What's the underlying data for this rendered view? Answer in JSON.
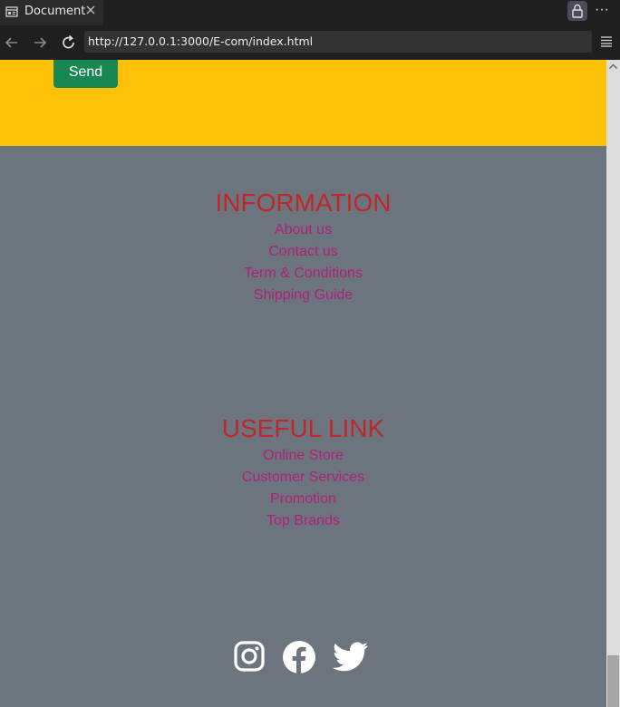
{
  "browser": {
    "tab_title": "Document",
    "url": "http://127.0.0.1:3000/E-com/index.html",
    "more_label": "···"
  },
  "page": {
    "send_label": "Send",
    "information": {
      "heading": "INFORMATION",
      "links": [
        "About us",
        "Contact us",
        "Term & Conditions",
        "Shipping Guide"
      ]
    },
    "useful": {
      "heading": "USEFUL LINK",
      "links": [
        "Online Store",
        "Customer Services",
        "Promotion",
        "Top Brands"
      ]
    },
    "social": [
      "instagram-icon",
      "facebook-icon",
      "twitter-icon"
    ]
  },
  "colors": {
    "yellow_band": "#ffc107",
    "footer_bg": "#6c757d",
    "send_button": "#198754",
    "heading": "#c0262a",
    "links": "#b0207a"
  }
}
